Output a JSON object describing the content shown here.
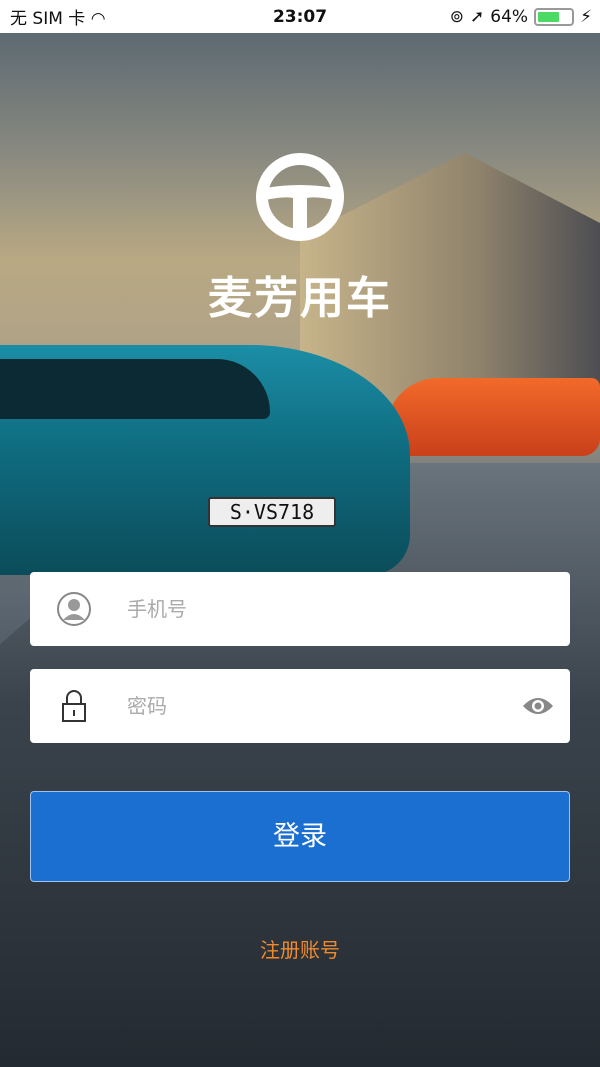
{
  "status_bar": {
    "carrier": "无 SIM 卡",
    "time": "23:07",
    "battery": "64%",
    "battery_level": 0.64
  },
  "brand": {
    "name": "麦芳用车",
    "plate": "S·VS718"
  },
  "form": {
    "phone_placeholder": "手机号",
    "password_placeholder": "密码",
    "login_label": "登录",
    "register_label": "注册账号"
  },
  "colors": {
    "accent": "#1b6fd0",
    "link": "#f08a2c"
  }
}
